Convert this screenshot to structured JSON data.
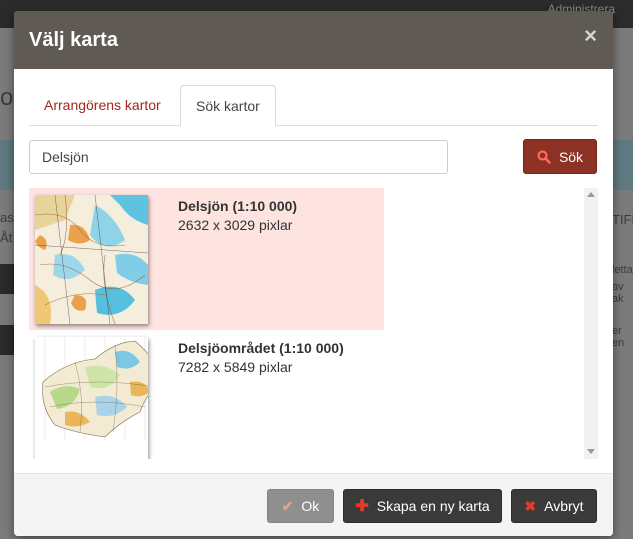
{
  "background": {
    "admin_label": "Administrera",
    "fragments": [
      "or",
      "as",
      "Åt",
      "TIFF",
      "letta",
      "av ak",
      "er en"
    ]
  },
  "modal": {
    "title": "Välj karta",
    "close_icon": "×"
  },
  "tabs": [
    {
      "label": "Arrangörens kartor",
      "active": false
    },
    {
      "label": "Sök kartor",
      "active": true
    }
  ],
  "search": {
    "value": "Delsjön",
    "button_label": "Sök"
  },
  "results": [
    {
      "name": "Delsjön (1:10 000)",
      "size": "2632 x 3029 pixlar",
      "selected": true
    },
    {
      "name": "Delsjöområdet (1:10 000)",
      "size": "7282 x 5849 pixlar",
      "selected": false
    }
  ],
  "footer": {
    "ok_label": "Ok",
    "new_label": "Skapa en ny karta",
    "cancel_label": "Avbryt"
  },
  "colors": {
    "header": "#5f5a54",
    "accent": "#a3271d",
    "search_button": "#8e3125",
    "selected_row": "#fde4e1",
    "dark_button": "#3a3a3a"
  }
}
